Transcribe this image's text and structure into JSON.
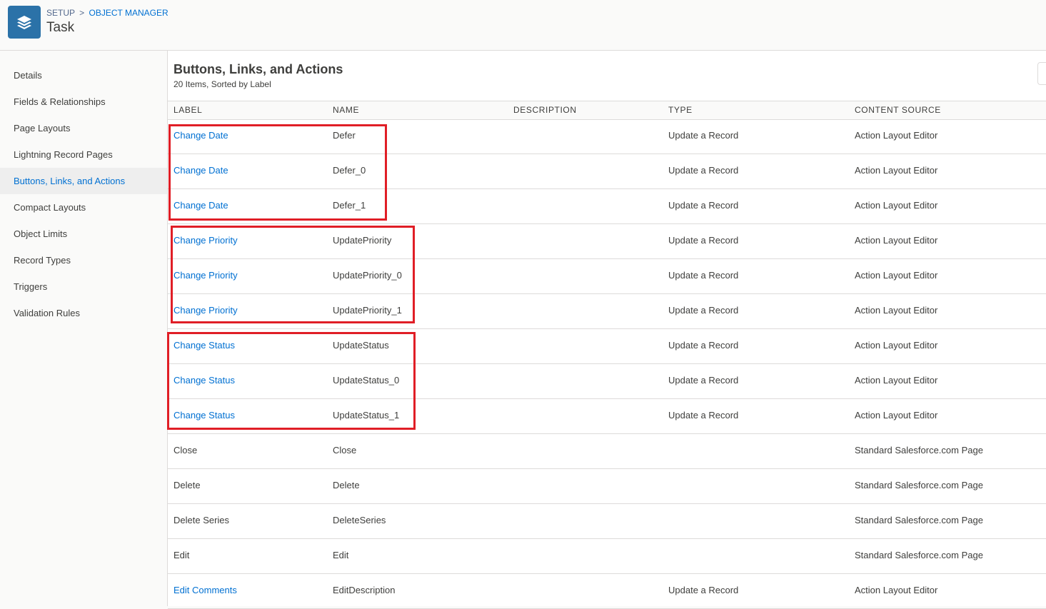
{
  "header": {
    "breadcrumb_root": "SETUP",
    "breadcrumb_sep": ">",
    "breadcrumb_link": "OBJECT MANAGER",
    "title": "Task"
  },
  "sidebar": {
    "items": [
      {
        "label": "Details"
      },
      {
        "label": "Fields & Relationships"
      },
      {
        "label": "Page Layouts"
      },
      {
        "label": "Lightning Record Pages"
      },
      {
        "label": "Buttons, Links, and Actions",
        "active": true
      },
      {
        "label": "Compact Layouts"
      },
      {
        "label": "Object Limits"
      },
      {
        "label": "Record Types"
      },
      {
        "label": "Triggers"
      },
      {
        "label": "Validation Rules"
      }
    ]
  },
  "main": {
    "title": "Buttons, Links, and Actions",
    "subtitle": "20 Items, Sorted by Label",
    "columns": [
      "LABEL",
      "NAME",
      "DESCRIPTION",
      "TYPE",
      "CONTENT SOURCE"
    ],
    "rows": [
      {
        "label": "Change Date",
        "name": "Defer",
        "description": "",
        "type": "Update a Record",
        "source": "Action Layout Editor",
        "link": true
      },
      {
        "label": "Change Date",
        "name": "Defer_0",
        "description": "",
        "type": "Update a Record",
        "source": "Action Layout Editor",
        "link": true
      },
      {
        "label": "Change Date",
        "name": "Defer_1",
        "description": "",
        "type": "Update a Record",
        "source": "Action Layout Editor",
        "link": true
      },
      {
        "label": "Change Priority",
        "name": "UpdatePriority",
        "description": "",
        "type": "Update a Record",
        "source": "Action Layout Editor",
        "link": true
      },
      {
        "label": "Change Priority",
        "name": "UpdatePriority_0",
        "description": "",
        "type": "Update a Record",
        "source": "Action Layout Editor",
        "link": true
      },
      {
        "label": "Change Priority",
        "name": "UpdatePriority_1",
        "description": "",
        "type": "Update a Record",
        "source": "Action Layout Editor",
        "link": true
      },
      {
        "label": "Change Status",
        "name": "UpdateStatus",
        "description": "",
        "type": "Update a Record",
        "source": "Action Layout Editor",
        "link": true
      },
      {
        "label": "Change Status",
        "name": "UpdateStatus_0",
        "description": "",
        "type": "Update a Record",
        "source": "Action Layout Editor",
        "link": true
      },
      {
        "label": "Change Status",
        "name": "UpdateStatus_1",
        "description": "",
        "type": "Update a Record",
        "source": "Action Layout Editor",
        "link": true
      },
      {
        "label": "Close",
        "name": "Close",
        "description": "",
        "type": "",
        "source": "Standard Salesforce.com Page",
        "link": false
      },
      {
        "label": "Delete",
        "name": "Delete",
        "description": "",
        "type": "",
        "source": "Standard Salesforce.com Page",
        "link": false
      },
      {
        "label": "Delete Series",
        "name": "DeleteSeries",
        "description": "",
        "type": "",
        "source": "Standard Salesforce.com Page",
        "link": false
      },
      {
        "label": "Edit",
        "name": "Edit",
        "description": "",
        "type": "",
        "source": "Standard Salesforce.com Page",
        "link": false
      },
      {
        "label": "Edit Comments",
        "name": "EditDescription",
        "description": "",
        "type": "Update a Record",
        "source": "Action Layout Editor",
        "link": true
      }
    ]
  },
  "colors": {
    "accent": "#0070d2",
    "app_icon": "#2b72a8",
    "highlight": "#e01e26"
  },
  "icons": {
    "app": "layers-icon"
  }
}
